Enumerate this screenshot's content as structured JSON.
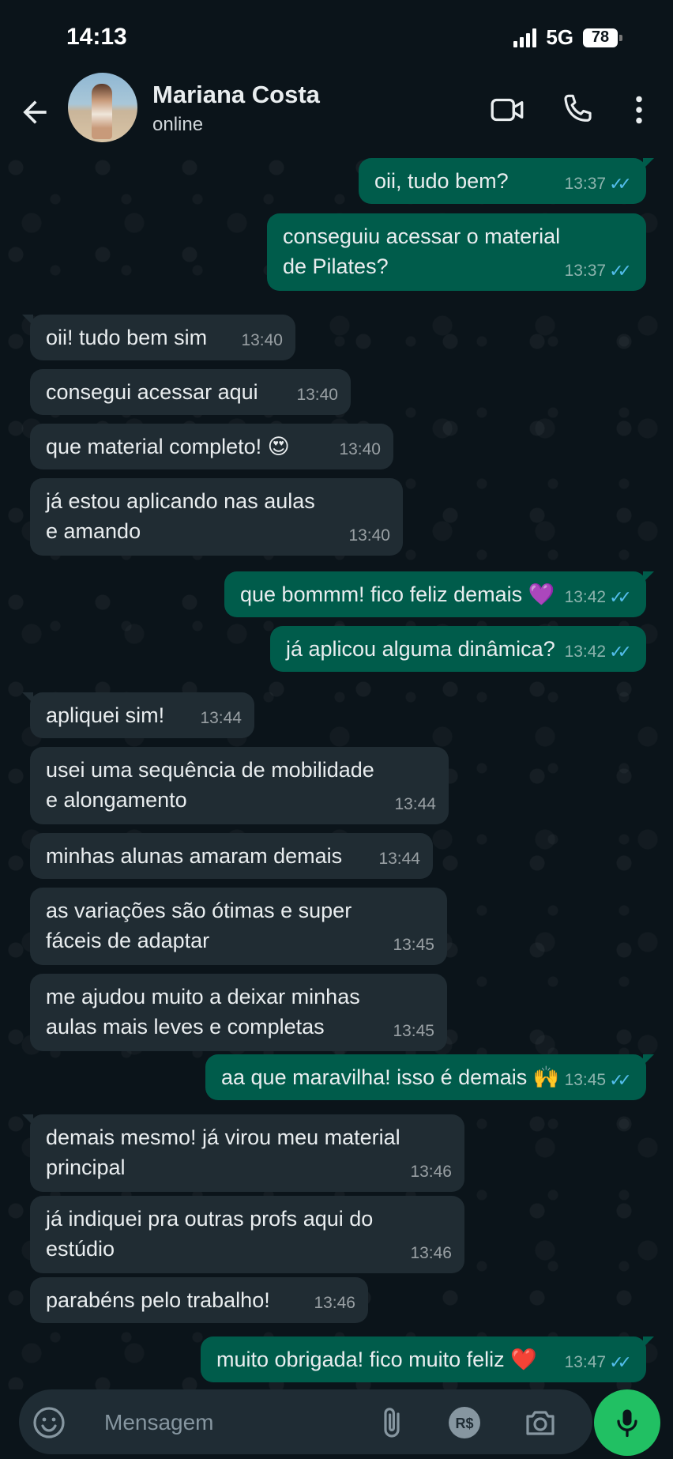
{
  "status_bar": {
    "time": "14:13",
    "network": "5G",
    "battery": "78"
  },
  "header": {
    "contact_name": "Mariana Costa",
    "contact_status": "online"
  },
  "messages": [
    {
      "dir": "out",
      "text": "oii, tudo bem?",
      "time": "13:37"
    },
    {
      "dir": "out",
      "text": "conseguiu acessar o material de Pilates?",
      "time": "13:37"
    },
    {
      "dir": "in",
      "text": "oii! tudo bem sim",
      "time": "13:40"
    },
    {
      "dir": "in",
      "text": "consegui acessar aqui",
      "time": "13:40"
    },
    {
      "dir": "in",
      "text": "que material completo! 😍",
      "time": "13:40"
    },
    {
      "dir": "in",
      "text": "já estou aplicando nas aulas e amando",
      "time": "13:40"
    },
    {
      "dir": "out",
      "text": "que bommm! fico feliz demais 💜",
      "time": "13:42"
    },
    {
      "dir": "out",
      "text": "já aplicou alguma dinâmica?",
      "time": "13:42"
    },
    {
      "dir": "in",
      "text": "apliquei sim!",
      "time": "13:44"
    },
    {
      "dir": "in",
      "text": "usei uma sequência de mobilidade e alongamento",
      "time": "13:44"
    },
    {
      "dir": "in",
      "text": "minhas alunas amaram demais",
      "time": "13:44"
    },
    {
      "dir": "in",
      "text": "as variações são ótimas e super fáceis de adaptar",
      "time": "13:45"
    },
    {
      "dir": "in",
      "text": "me ajudou muito a deixar minhas aulas mais leves e completas",
      "time": "13:45"
    },
    {
      "dir": "out",
      "text": "aa que maravilha! isso é demais 🙌",
      "time": "13:45"
    },
    {
      "dir": "in",
      "text": "demais mesmo! já virou meu material principal",
      "time": "13:46"
    },
    {
      "dir": "in",
      "text": "já indiquei pra outras profs aqui do estúdio",
      "time": "13:46"
    },
    {
      "dir": "in",
      "text": "parabéns pelo trabalho!",
      "time": "13:46"
    },
    {
      "dir": "out",
      "text": "muito obrigada! fico muito feliz ❤️",
      "time": "13:47"
    }
  ],
  "composer": {
    "placeholder": "Mensagem"
  },
  "icons": {
    "back": "arrow-left-icon",
    "video": "video-call-icon",
    "call": "phone-icon",
    "menu": "more-vert-icon",
    "emoji": "emoji-icon",
    "attach": "paperclip-icon",
    "payment": "payment-rs-icon",
    "camera": "camera-icon",
    "mic": "mic-icon"
  },
  "colors": {
    "background": "#0b141a",
    "incoming": "#202c33",
    "outgoing": "#005c4b",
    "accent": "#21c063",
    "read_ticks": "#53bdeb"
  }
}
